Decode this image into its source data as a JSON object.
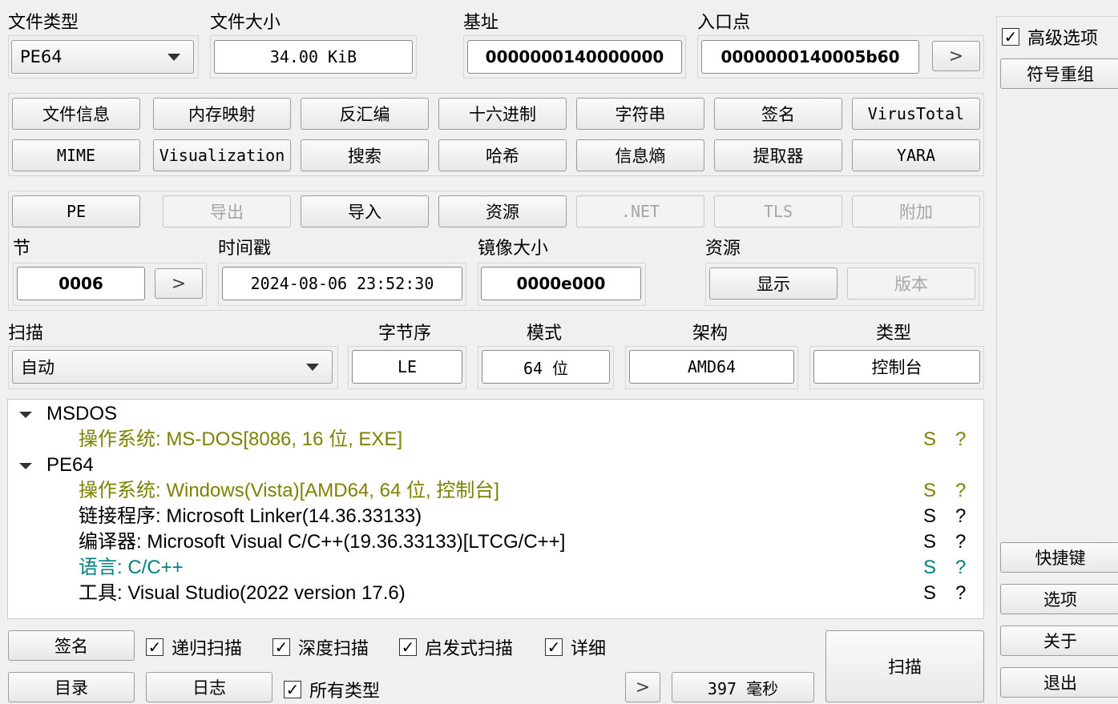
{
  "top": {
    "file_type_label": "文件类型",
    "file_type_value": "PE64",
    "file_size_label": "文件大小",
    "file_size_value": "34.00 KiB",
    "base_label": "基址",
    "base_value": "0000000140000000",
    "entry_label": "入口点",
    "entry_value": "0000000140005b60",
    "entry_next": ">"
  },
  "tools": {
    "row1": [
      "文件信息",
      "内存映射",
      "反汇编",
      "十六进制",
      "字符串",
      "签名",
      "VirusTotal"
    ],
    "row2": [
      "MIME",
      "Visualization",
      "搜索",
      "哈希",
      "信息熵",
      "提取器",
      "YARA"
    ]
  },
  "pe": {
    "tabs": [
      {
        "label": "PE",
        "enabled": true
      },
      {
        "label": "导出",
        "enabled": false
      },
      {
        "label": "导入",
        "enabled": true
      },
      {
        "label": "资源",
        "enabled": true
      },
      {
        "label": ".NET",
        "enabled": false
      },
      {
        "label": "TLS",
        "enabled": false
      },
      {
        "label": "附加",
        "enabled": false
      }
    ],
    "section_label": "节",
    "section_value": "0006",
    "section_next": ">",
    "timestamp_label": "时间戳",
    "timestamp_value": "2024-08-06 23:52:30",
    "image_size_label": "镜像大小",
    "image_size_value": "0000e000",
    "resources_label": "资源",
    "show_button": "显示",
    "version_button": "版本"
  },
  "scan_opts": {
    "scan_label": "扫描",
    "scan_value": "自动",
    "endian_label": "字节序",
    "endian_value": "LE",
    "mode_label": "模式",
    "mode_value": "64 位",
    "arch_label": "架构",
    "arch_value": "AMD64",
    "type_label": "类型",
    "type_value": "控制台"
  },
  "colors": {
    "os": "#808000",
    "lang": "#008080",
    "normal": "#000000"
  },
  "results": [
    {
      "kind": "group",
      "text": "MSDOS"
    },
    {
      "kind": "item",
      "color": "os",
      "text": "操作系统: MS-DOS[8086, 16 位, EXE]",
      "s": "S",
      "q": "?"
    },
    {
      "kind": "group",
      "text": "PE64"
    },
    {
      "kind": "item",
      "color": "os",
      "text": "操作系统: Windows(Vista)[AMD64, 64 位, 控制台]",
      "s": "S",
      "q": "?"
    },
    {
      "kind": "item",
      "color": "normal",
      "text": "链接程序: Microsoft Linker(14.36.33133)",
      "s": "S",
      "q": "?"
    },
    {
      "kind": "item",
      "color": "normal",
      "text": "编译器: Microsoft Visual C/C++(19.36.33133)[LTCG/C++]",
      "s": "S",
      "q": "?"
    },
    {
      "kind": "item",
      "color": "lang",
      "text": "语言: C/C++",
      "s": "S",
      "q": "?"
    },
    {
      "kind": "item",
      "color": "normal",
      "text": "工具: Visual Studio(2022 version 17.6)",
      "s": "S",
      "q": "?"
    }
  ],
  "bottom": {
    "signature_button": "签名",
    "recursive_label": "递归扫描",
    "recursive_checked": true,
    "deep_label": "深度扫描",
    "deep_checked": true,
    "heuristic_label": "启发式扫描",
    "heuristic_checked": true,
    "verbose_label": "详细",
    "verbose_checked": true,
    "directory_button": "目录",
    "log_button": "日志",
    "all_types_label": "所有类型",
    "all_types_checked": true,
    "more_button": ">",
    "time_value": "397 毫秒",
    "scan_button": "扫描"
  },
  "sidebar": {
    "advanced_label": "高级选项",
    "advanced_checked": true,
    "demangle_button": "符号重组",
    "shortcuts_button": "快捷键",
    "options_button": "选项",
    "about_button": "关于",
    "exit_button": "退出"
  }
}
